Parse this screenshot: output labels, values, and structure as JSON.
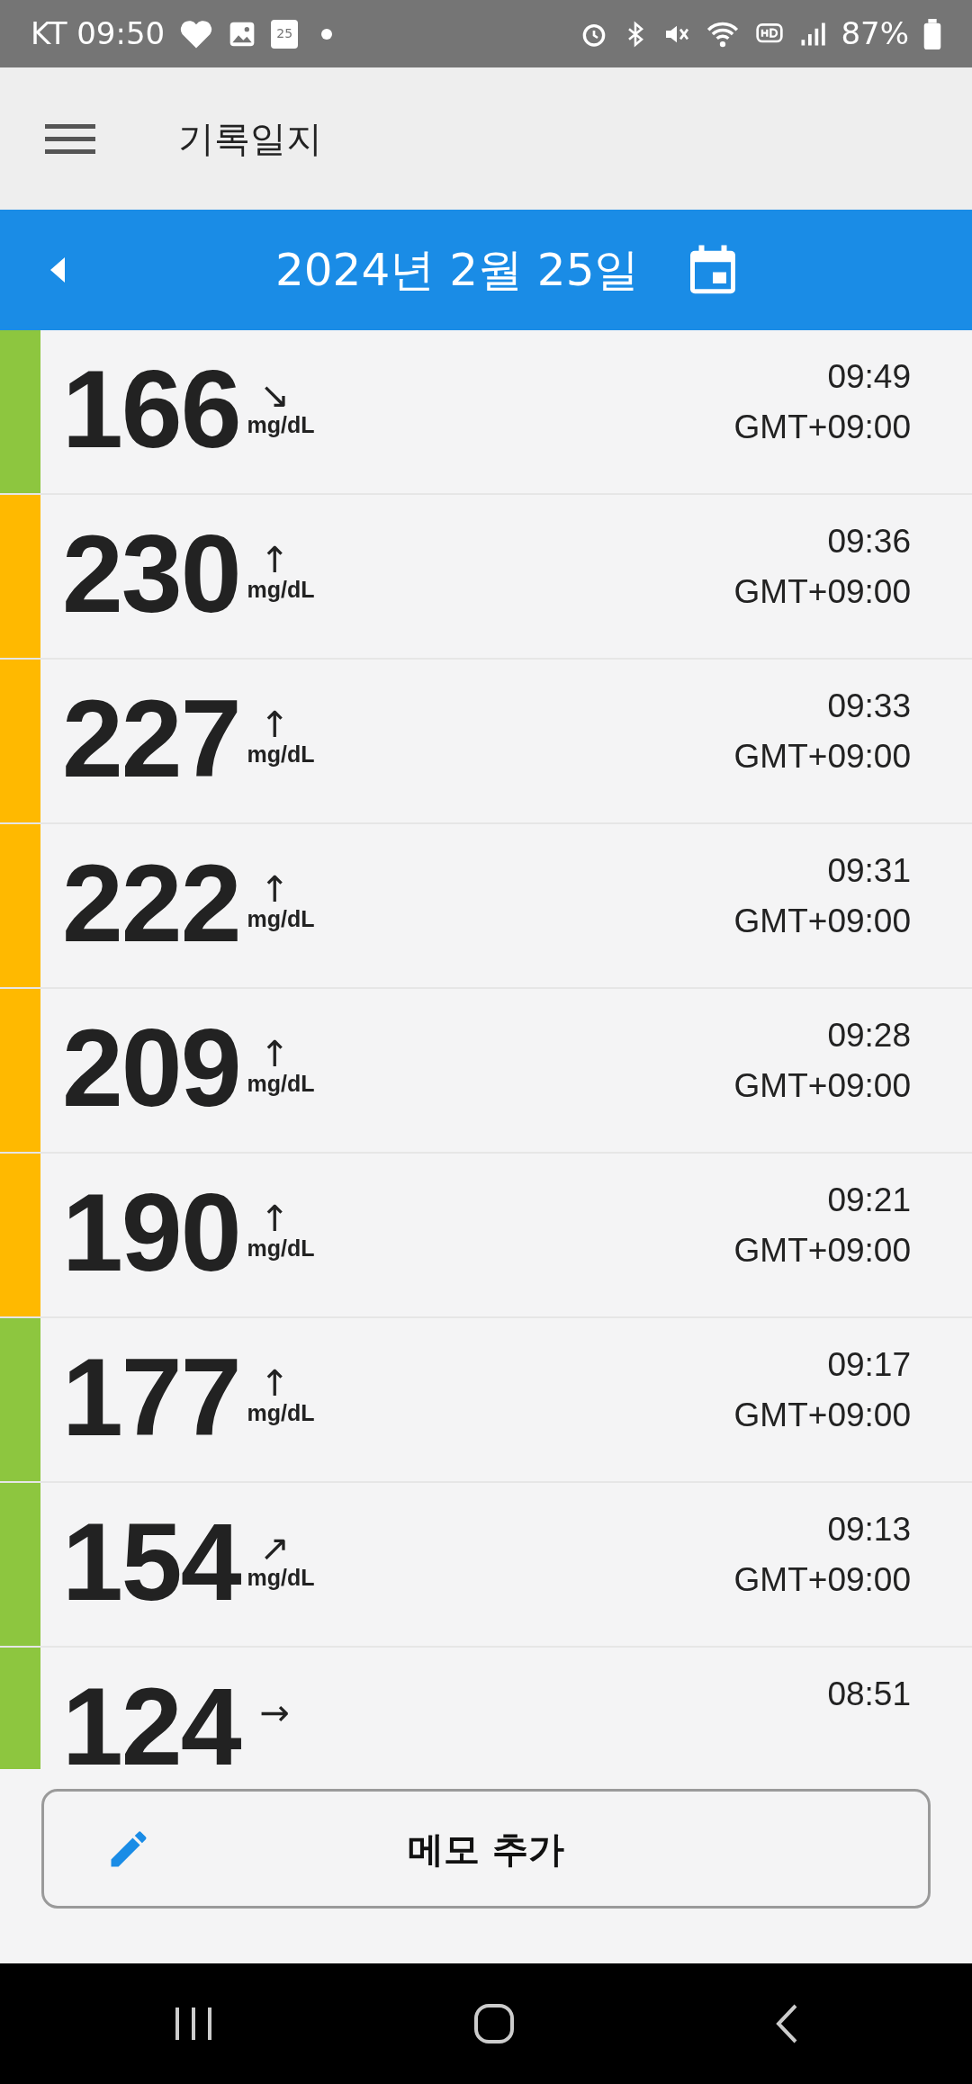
{
  "status_bar": {
    "carrier_time": "KT 09:50",
    "calendar_day": "25",
    "battery": "87%"
  },
  "app_bar": {
    "title": "기록일지"
  },
  "date_bar": {
    "date": "2024년 2월 25일"
  },
  "readings": [
    {
      "value": "166",
      "unit": "mg/dL",
      "trend": "↘",
      "time": "09:49",
      "timezone": "GMT+09:00",
      "color": "#8dc63f"
    },
    {
      "value": "230",
      "unit": "mg/dL",
      "trend": "↑",
      "time": "09:36",
      "timezone": "GMT+09:00",
      "color": "#ffb900"
    },
    {
      "value": "227",
      "unit": "mg/dL",
      "trend": "↑",
      "time": "09:33",
      "timezone": "GMT+09:00",
      "color": "#ffb900"
    },
    {
      "value": "222",
      "unit": "mg/dL",
      "trend": "↑",
      "time": "09:31",
      "timezone": "GMT+09:00",
      "color": "#ffb900"
    },
    {
      "value": "209",
      "unit": "mg/dL",
      "trend": "↑",
      "time": "09:28",
      "timezone": "GMT+09:00",
      "color": "#ffb900"
    },
    {
      "value": "190",
      "unit": "mg/dL",
      "trend": "↑",
      "time": "09:21",
      "timezone": "GMT+09:00",
      "color": "#ffb900"
    },
    {
      "value": "177",
      "unit": "mg/dL",
      "trend": "↑",
      "time": "09:17",
      "timezone": "GMT+09:00",
      "color": "#8dc63f"
    },
    {
      "value": "154",
      "unit": "mg/dL",
      "trend": "↗",
      "time": "09:13",
      "timezone": "GMT+09:00",
      "color": "#8dc63f"
    },
    {
      "value": "124",
      "trend": "→",
      "time": "08:51",
      "color": "#8dc63f"
    }
  ],
  "memo_button": {
    "label": "메모 추가"
  }
}
